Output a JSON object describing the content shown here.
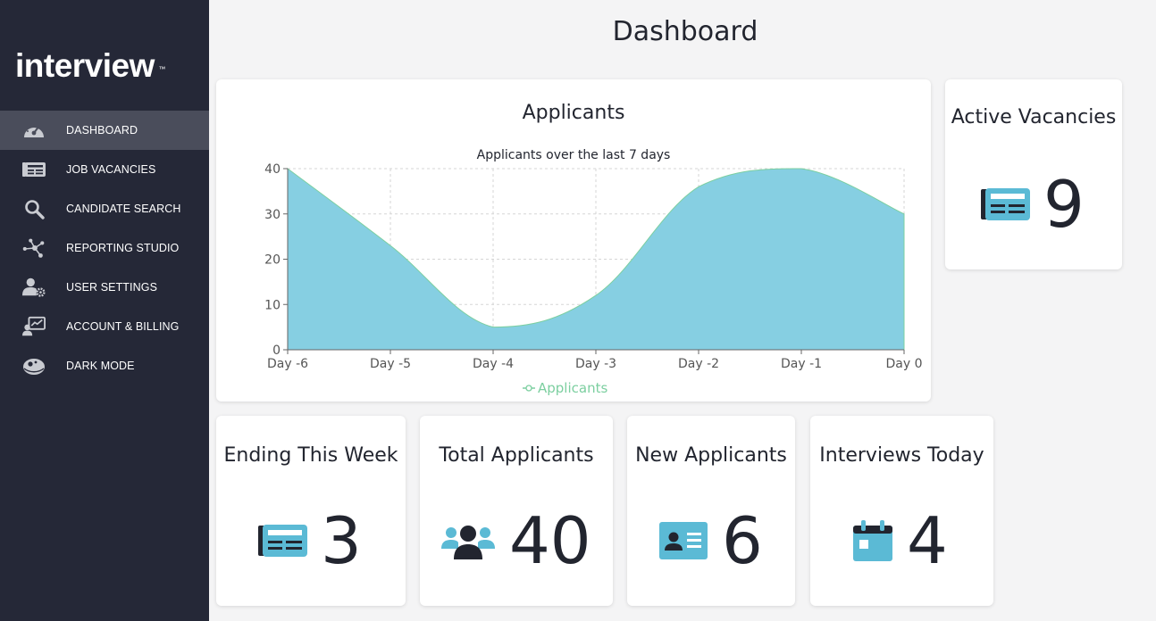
{
  "app": {
    "logo_text": "interview",
    "logo_tm": "™"
  },
  "sidebar": {
    "items": [
      {
        "label": "DASHBOARD",
        "icon": "speedometer-icon",
        "active": true
      },
      {
        "label": "JOB VACANCIES",
        "icon": "newspaper-icon",
        "active": false
      },
      {
        "label": "CANDIDATE SEARCH",
        "icon": "search-icon",
        "active": false
      },
      {
        "label": "REPORTING STUDIO",
        "icon": "network-nodes-icon",
        "active": false
      },
      {
        "label": "USER SETTINGS",
        "icon": "user-gear-icon",
        "active": false
      },
      {
        "label": "ACCOUNT & BILLING",
        "icon": "user-chart-icon",
        "active": false
      },
      {
        "label": "DARK MODE",
        "icon": "dark-mode-icon",
        "active": false
      }
    ]
  },
  "page": {
    "title": "Dashboard"
  },
  "chart_card": {
    "title": "Applicants"
  },
  "chart_data": {
    "type": "area",
    "title": "Applicants over the last 7 days",
    "categories": [
      "Day -6",
      "Day -5",
      "Day -4",
      "Day -3",
      "Day -2",
      "Day -1",
      "Day 0"
    ],
    "series": [
      {
        "name": "Applicants",
        "values": [
          40,
          23,
          5,
          12,
          36,
          40,
          30
        ]
      }
    ],
    "yticks": [
      "0",
      "10",
      "20",
      "30",
      "40"
    ],
    "ylim": [
      0,
      40
    ],
    "grid": true,
    "legend": "bottom",
    "colors": {
      "fill": "#86cfe2",
      "line": "#7ccfa0",
      "legend_text": "#7ccfa0"
    }
  },
  "stats": [
    {
      "title": "Active Vacancies",
      "value": "9",
      "icon": "newspaper-icon"
    },
    {
      "title": "Ending This Week",
      "value": "3",
      "icon": "newspaper-icon"
    },
    {
      "title": "Total Applicants",
      "value": "40",
      "icon": "users-group-icon"
    },
    {
      "title": "New Applicants",
      "value": "6",
      "icon": "id-card-icon"
    },
    {
      "title": "Interviews Today",
      "value": "4",
      "icon": "calendar-icon"
    }
  ],
  "colors": {
    "accent": "#5bbad5",
    "sidebar_bg": "#252837",
    "sidebar_active": "#4a4d5b",
    "text_dark": "#22252f"
  }
}
